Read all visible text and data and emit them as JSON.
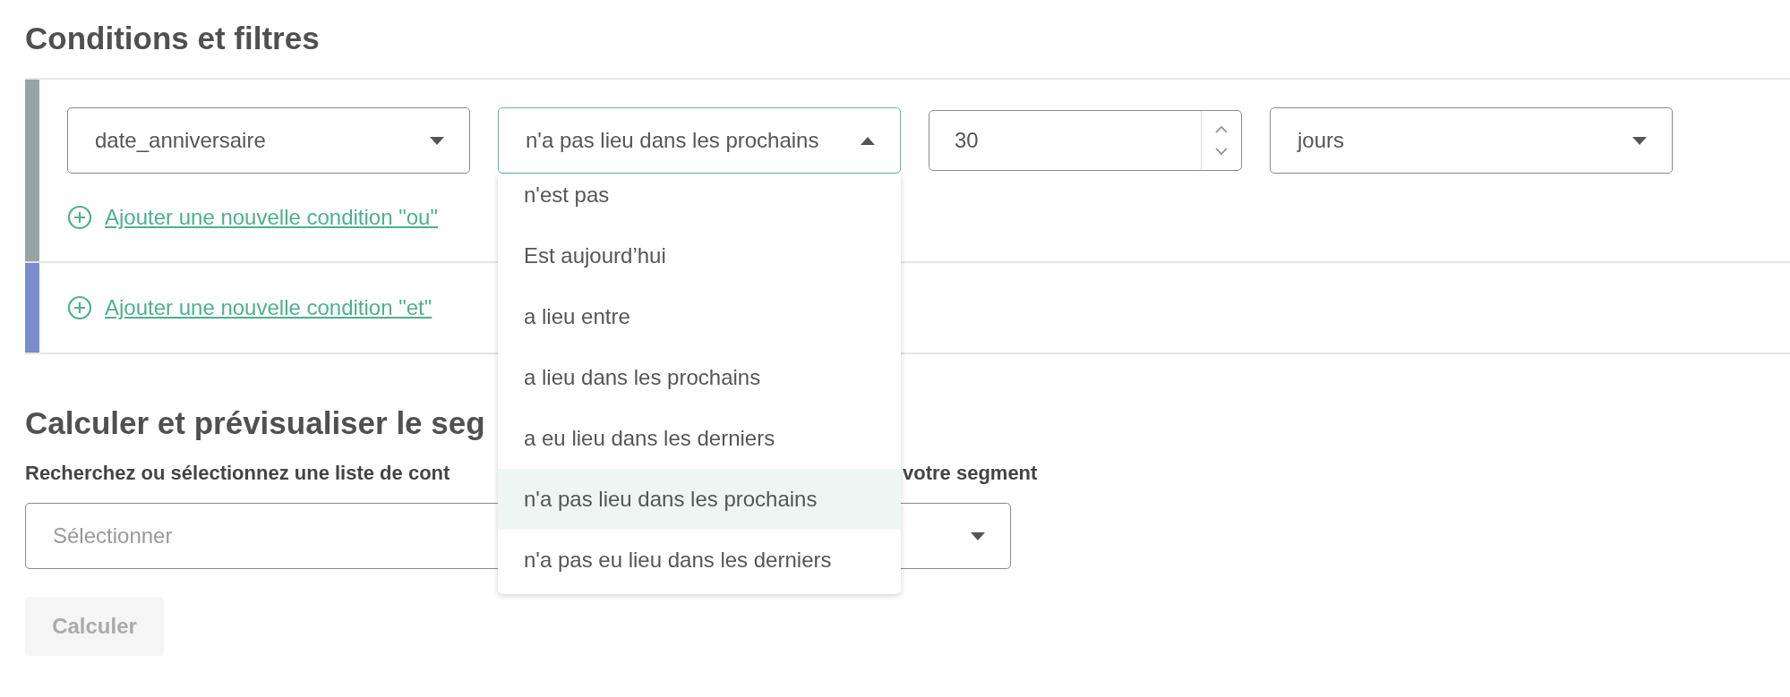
{
  "title": "Conditions et filtres",
  "condition_groups": [
    {
      "color": "#95a5a3",
      "condition": {
        "field": "date_anniversaire",
        "operator": {
          "value": "n'a pas lieu dans les prochains",
          "expanded": true,
          "options": [
            {
              "label": "n'est pas",
              "selected": false
            },
            {
              "label": "Est aujourd’hui",
              "selected": false
            },
            {
              "label": "a lieu entre",
              "selected": false
            },
            {
              "label": "a lieu dans les prochains",
              "selected": false
            },
            {
              "label": "a eu lieu dans les derniers",
              "selected": false
            },
            {
              "label": "n'a pas lieu dans les prochains",
              "selected": true
            },
            {
              "label": "n'a pas eu lieu dans les derniers",
              "selected": false
            }
          ]
        },
        "amount": "30",
        "unit": "jours"
      },
      "add_link": "Ajouter une nouvelle condition \"ou\""
    },
    {
      "color": "#7b8ccc",
      "add_link": "Ajouter une nouvelle condition \"et\""
    }
  ],
  "preview": {
    "title": "Calculer et prévisualiser le seg",
    "label_start": "Recherchez ou sélectionnez une liste de cont",
    "label_end": "votre segment",
    "select": {
      "placeholder": "Sélectionner"
    },
    "button": {
      "label": "Calculer",
      "disabled": true
    }
  }
}
